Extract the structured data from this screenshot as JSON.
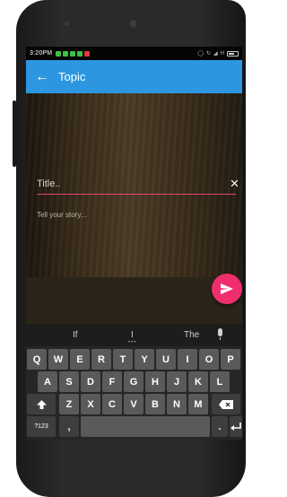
{
  "status_bar": {
    "time": "3:20PM",
    "network": "H",
    "notification_colors": [
      "#3fbf3f",
      "#3fbf3f",
      "#3fbf3f",
      "#3fbf3f",
      "#e0393f"
    ]
  },
  "app_bar": {
    "back_icon": "arrow-back-icon",
    "title": "Topic",
    "color": "#2c97e0"
  },
  "form": {
    "title_placeholder": "Title..",
    "clear_icon": "close-icon",
    "story_placeholder": "Tell your story...",
    "underline_color": "#e24672"
  },
  "fab": {
    "icon": "send-icon",
    "color": "#ee2e6d"
  },
  "keyboard": {
    "suggestions": [
      "If",
      "I",
      "The"
    ],
    "row1": [
      "Q",
      "W",
      "E",
      "R",
      "T",
      "Y",
      "U",
      "I",
      "O",
      "P"
    ],
    "row2": [
      "A",
      "S",
      "D",
      "F",
      "G",
      "H",
      "J",
      "K",
      "L"
    ],
    "row3": [
      "Z",
      "X",
      "C",
      "V",
      "B",
      "N",
      "M"
    ],
    "shift_icon": "shift-arrow-icon",
    "backspace_icon": "backspace-icon",
    "symbols_label": "?123",
    "comma_label": ",",
    "period_label": ".",
    "enter_icon": "enter-icon",
    "mic_icon": "microphone-icon"
  }
}
